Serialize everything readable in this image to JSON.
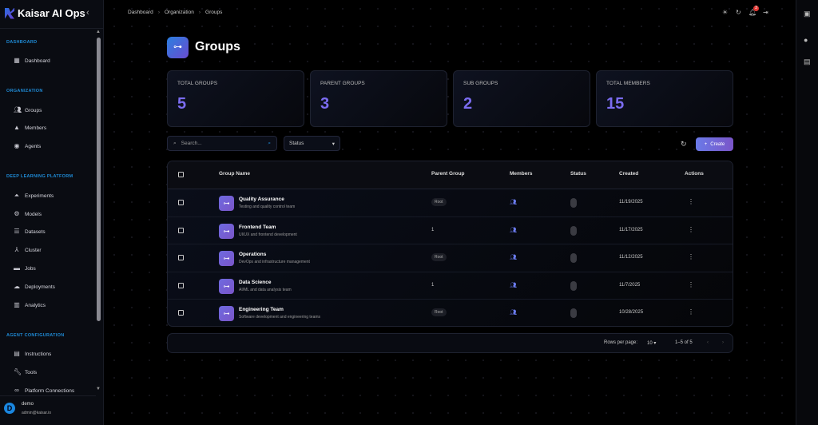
{
  "app": {
    "name": "Kaisar AI Ops"
  },
  "sidebar": {
    "sections": [
      {
        "label": "DASHBOARD",
        "items": [
          {
            "label": "Dashboard",
            "icon": "dashboard-icon"
          }
        ]
      },
      {
        "label": "ORGANIZATION",
        "items": [
          {
            "label": "Groups",
            "icon": "groups-icon"
          },
          {
            "label": "Members",
            "icon": "person-icon"
          },
          {
            "label": "Agents",
            "icon": "robot-icon"
          }
        ]
      },
      {
        "label": "DEEP LEARNING PLATFORM",
        "items": [
          {
            "label": "Experiments",
            "icon": "flask-icon"
          },
          {
            "label": "Models",
            "icon": "chip-icon"
          },
          {
            "label": "Datasets",
            "icon": "list-icon"
          },
          {
            "label": "Cluster",
            "icon": "hub-icon"
          },
          {
            "label": "Jobs",
            "icon": "briefcase-icon"
          },
          {
            "label": "Deployments",
            "icon": "cloud-upload-icon"
          },
          {
            "label": "Analytics",
            "icon": "analytics-icon"
          }
        ]
      },
      {
        "label": "AGENT CONFIGURATION",
        "items": [
          {
            "label": "Instructions",
            "icon": "document-icon"
          },
          {
            "label": "Tools",
            "icon": "wrench-icon"
          },
          {
            "label": "Platform Connections",
            "icon": "link-icon"
          }
        ]
      }
    ],
    "user": {
      "initial": "D",
      "name": "demo",
      "email": "admin@kaisar.io"
    }
  },
  "breadcrumb": [
    "Dashboard",
    "Organization",
    "Groups"
  ],
  "topbar": {
    "notification_count": "3"
  },
  "page": {
    "title": "Groups"
  },
  "stats": [
    {
      "label": "TOTAL GROUPS",
      "value": "5"
    },
    {
      "label": "PARENT GROUPS",
      "value": "3"
    },
    {
      "label": "SUB GROUPS",
      "value": "2"
    },
    {
      "label": "TOTAL MEMBERS",
      "value": "15"
    }
  ],
  "toolbar": {
    "search_placeholder": "Search...",
    "status_label": "Status",
    "create_label": "Create"
  },
  "table": {
    "columns": [
      "Group Name",
      "Parent Group",
      "Members",
      "Status",
      "Created",
      "Actions"
    ],
    "rows": [
      {
        "name": "Quality Assurance",
        "desc": "Testing and quality control team",
        "parent": "Root",
        "created": "11/19/2025"
      },
      {
        "name": "Frontend Team",
        "desc": "UI/UX and frontend development",
        "parent": "1",
        "created": "11/17/2025"
      },
      {
        "name": "Operations",
        "desc": "DevOps and infrastructure management",
        "parent": "Root",
        "created": "11/12/2025"
      },
      {
        "name": "Data Science",
        "desc": "AI/ML and data analysis team",
        "parent": "1",
        "created": "11/7/2025"
      },
      {
        "name": "Engineering Team",
        "desc": "Software development and engineering teams",
        "parent": "Root",
        "created": "10/28/2025"
      }
    ]
  },
  "pagination": {
    "rows_per_page_label": "Rows per page:",
    "rows_per_page": "10",
    "range": "1–5 of 5"
  },
  "colors": {
    "accent": "#7b6cf0",
    "section": "#1f8bd6",
    "badge": "#e53935"
  }
}
